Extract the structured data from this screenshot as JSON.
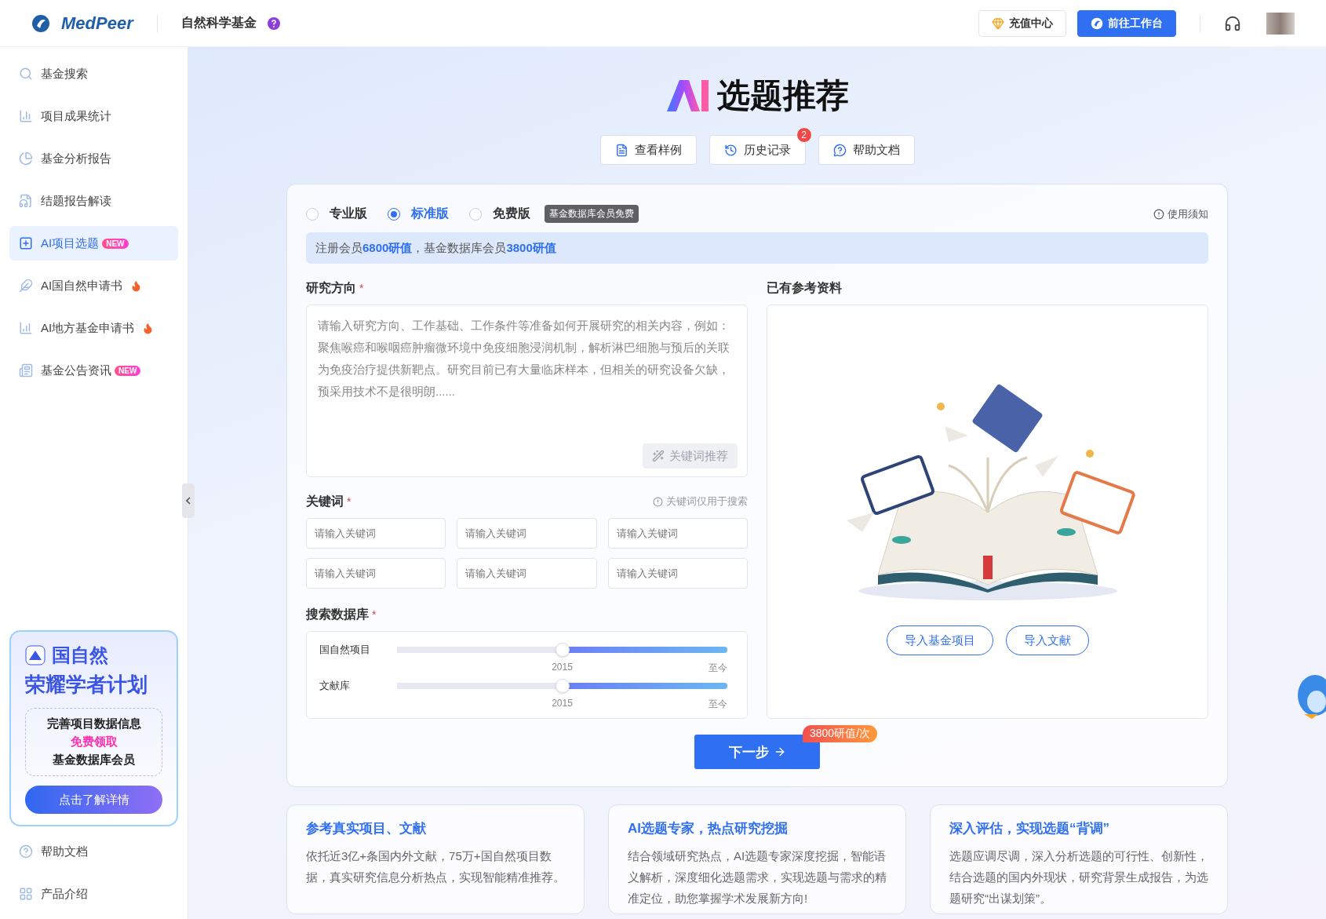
{
  "header": {
    "logo": "MedPeer",
    "section": "自然科学基金",
    "recharge": "充值中心",
    "workbench": "前往工作台"
  },
  "sidebar": {
    "items": [
      {
        "label": "基金搜索",
        "selected": false
      },
      {
        "label": "项目成果统计",
        "selected": false
      },
      {
        "label": "基金分析报告",
        "selected": false
      },
      {
        "label": "结题报告解读",
        "selected": false
      },
      {
        "label": "AI项目选题",
        "selected": true,
        "badge": "NEW"
      },
      {
        "label": "AI国自然申请书",
        "selected": false,
        "hot": true
      },
      {
        "label": "AI地方基金申请书",
        "selected": false,
        "hot": true
      },
      {
        "label": "基金公告资讯",
        "selected": false,
        "badge": "NEW"
      }
    ],
    "promo": {
      "brand": "国自然",
      "title": "荣耀学者计划",
      "lines": [
        {
          "text": "完善项目数据信息",
          "kind": "plain"
        },
        {
          "text": "免费领取",
          "kind": "highlight"
        },
        {
          "text": "基金数据库会员",
          "kind": "plain"
        }
      ],
      "button": "点击了解详情"
    },
    "footer": [
      "帮助文档",
      "产品介绍"
    ]
  },
  "main": {
    "title": "选题推荐",
    "actions": [
      {
        "label": "查看样例"
      },
      {
        "label": "历史记录",
        "badge": "2"
      },
      {
        "label": "帮助文档"
      }
    ],
    "form": {
      "versions": [
        {
          "label": "专业版",
          "selected": false
        },
        {
          "label": "标准版",
          "selected": true
        },
        {
          "label": "免费版",
          "selected": false
        }
      ],
      "free_tag": "基金数据库会员免费",
      "notice": "使用须知",
      "price_note": "注册会员**6800研值**，基金数据库会员**3800研值**",
      "research": {
        "label": "研究方向",
        "required_mark": "*",
        "placeholder": "请输入研究方向、工作基础、工作条件等准备如何开展研究的相关内容，例如：聚焦喉癌和喉咽癌肿瘤微环境中免疫细胞浸润机制，解析淋巴细胞与预后的关联为免疫治疗提供新靶点。研究目前已有大量临床样本，但相关的研究设备欠缺，预采用技术不是很明朗......",
        "keyword_button": "关键词推荐",
        "keyword_button_disabled": true
      },
      "keywords": {
        "label": "关键词",
        "required_mark": "*",
        "hint": "关键词仅用于搜索",
        "fields": [
          {
            "placeholder": "请输入关键词"
          },
          {
            "placeholder": "请输入关键词"
          },
          {
            "placeholder": "请输入关键词"
          },
          {
            "placeholder": "请输入关键词"
          },
          {
            "placeholder": "请输入关键词"
          },
          {
            "placeholder": "请输入关键词"
          }
        ]
      },
      "database": {
        "label": "搜索数据库",
        "required_mark": "*",
        "sliders": [
          {
            "name": "国自然项目",
            "level": 0.5,
            "start": "2015",
            "end": "至今"
          },
          {
            "name": "文献库",
            "level": 0.5,
            "start": "2015",
            "end": "至今"
          }
        ]
      },
      "references": {
        "label": "已有参考资料",
        "buttons": [
          "导入基金项目",
          "导入文献"
        ]
      },
      "next": {
        "label": "下一步",
        "price": "3800研值/次"
      }
    },
    "features": [
      {
        "title": "参考真实项目、文献",
        "text": "依托近3亿+条国内外文献，75万+国自然项目数据，真实研究信息分析热点，实现智能精准推荐。"
      },
      {
        "title": "AI选题专家，热点研究挖掘",
        "text": "结合领域研究热点，AI选题专家深度挖掘，智能语义解析，深度细化选题需求，实现选题与需求的精准定位，助您掌握学术发展新方向!"
      },
      {
        "title": "深入评估，实现选题“背调”",
        "text": "选题应调尽调，深入分析选题的可行性、创新性，结合选题的国内外现状，研究背景生成报告，为选题研究“出谋划策”。"
      }
    ]
  }
}
